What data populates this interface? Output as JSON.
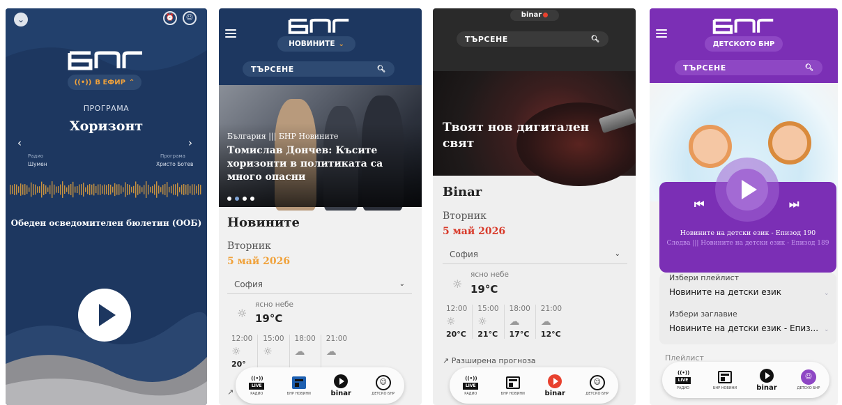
{
  "screen1": {
    "brand": "БНР",
    "on_air": "В ЕФИР",
    "program_label": "ПРОГРАМА",
    "station": "Хоризонт",
    "left": {
      "label": "Радио",
      "value": "Шумен"
    },
    "right": {
      "label": "Програма",
      "value": "Христо Ботев"
    },
    "show": "Обеден осведомителен бюлетин (ООБ)"
  },
  "screen2": {
    "brand": "БНР",
    "section_pill": "НОВИНИТЕ",
    "search": "ТЪРСЕНЕ",
    "kicker": "България ||| БНР Новините",
    "headline": "Томислав Дончев: Късите хоризонти в политиката са много опасни",
    "section_title": "Новините",
    "day": "Вторник",
    "date": "5 май 2026",
    "city": "София",
    "weather_now_label": "ясно небе",
    "weather_now_temp": "19°C",
    "hours": [
      {
        "time": "12:00",
        "temp": "20°"
      },
      {
        "time": "15:00",
        "temp": ""
      },
      {
        "time": "18:00",
        "temp": ""
      },
      {
        "time": "21:00",
        "temp": ""
      }
    ]
  },
  "screen3": {
    "brand": "binar",
    "search": "ТЪРСЕНЕ",
    "hero_title": "Твоят нов дигитален свят",
    "section_title": "Binar",
    "day": "Вторник",
    "date": "5 май 2026",
    "city": "София",
    "weather_now_label": "ясно небе",
    "weather_now_temp": "19°C",
    "hours": [
      {
        "time": "12:00",
        "temp": "20°C"
      },
      {
        "time": "15:00",
        "temp": "21°C"
      },
      {
        "time": "18:00",
        "temp": "17°C"
      },
      {
        "time": "21:00",
        "temp": "12°C"
      }
    ],
    "extended": "Разширена прогноза"
  },
  "screen4": {
    "brand": "БНР",
    "section_pill": "ДЕТСКОТО БНР",
    "search": "ТЪРСЕНЕ",
    "now_playing": "Новините на детски език - Епизод 190",
    "up_next": "Следва ||| Новините на детски език - Епизод 189",
    "pick_playlist_label": "Избери плейлист",
    "pick_playlist_value": "Новините на детски език",
    "pick_title_label": "Избери заглавие",
    "pick_title_value": "Новините на детски език - Епиз...",
    "playlist_label": "Плейлист"
  },
  "navbar": {
    "radio_tag": "LIVE",
    "radio": "РАДИО",
    "news": "БНР НОВИНИ",
    "binar": "binar",
    "kids": "ДЕТСКО БНР"
  },
  "colors": {
    "bnr_navy": "#1d3760",
    "accent_orange": "#f0a23b",
    "kids_purple": "#7b2fb5",
    "binar_red": "#e8412e"
  }
}
